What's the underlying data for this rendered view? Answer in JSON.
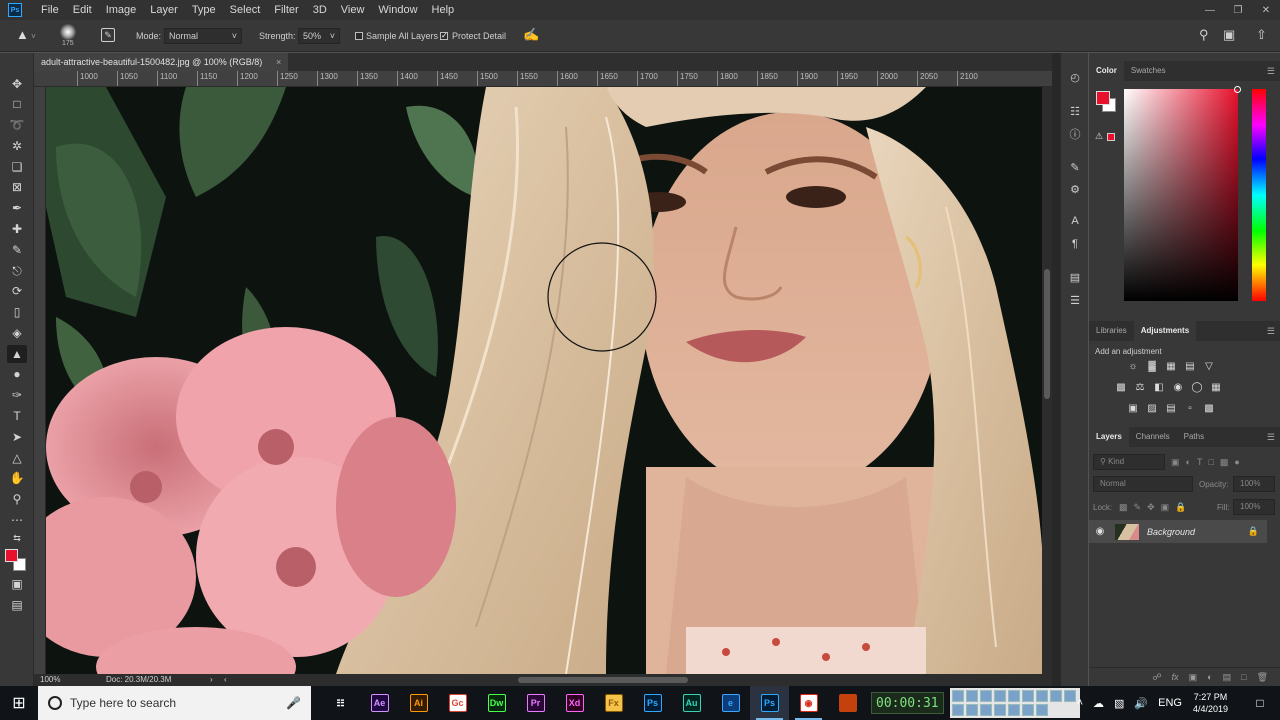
{
  "menu": {
    "app_icon": "Ps",
    "items": [
      "File",
      "Edit",
      "Image",
      "Layer",
      "Type",
      "Select",
      "Filter",
      "3D",
      "View",
      "Window",
      "Help"
    ]
  },
  "options_bar": {
    "brush_size": "175",
    "mode_label": "Mode:",
    "mode_value": "Normal",
    "strength_label": "Strength:",
    "strength_value": "50%",
    "sample_all_layers": "Sample All Layers",
    "sample_all_layers_checked": false,
    "protect_detail": "Protect Detail",
    "protect_detail_checked": true
  },
  "document": {
    "tab_title": "adult-attractive-beautiful-1500482.jpg @ 100% (RGB/8)",
    "close_glyph": "×",
    "ruler_ticks": [
      "1000",
      "1050",
      "1100",
      "1150",
      "1200",
      "1250",
      "1300",
      "1350",
      "1400",
      "1450",
      "1500",
      "1550",
      "1600",
      "1650",
      "1700",
      "1750",
      "1800",
      "1850",
      "1900",
      "1950",
      "2000",
      "2050",
      "2100"
    ],
    "zoom": "100%",
    "doc_size": "Doc: 20.3M/20.3M"
  },
  "colors": {
    "foreground": "#e8112d",
    "background": "#ffffff",
    "ps_blue": "#31a8ff"
  },
  "panels": {
    "color_tabs": [
      "Color",
      "Swatches"
    ],
    "adjust_tabs": [
      "Libraries",
      "Adjustments"
    ],
    "adjust_label": "Add an adjustment",
    "layers_tabs": [
      "Layers",
      "Channels",
      "Paths"
    ],
    "kind_placeholder": "Kind",
    "blend_mode": "Normal",
    "opacity_label": "Opacity:",
    "opacity_value": "100%",
    "lock_label": "Lock:",
    "fill_label": "Fill:",
    "fill_value": "100%",
    "layer_name": "Background"
  },
  "taskbar": {
    "search_placeholder": "Type here to search",
    "apps": [
      {
        "name": "Ae",
        "bg": "#1f0740",
        "fg": "#d291ff"
      },
      {
        "name": "Ai",
        "bg": "#331c00",
        "fg": "#ff9a00"
      },
      {
        "name": "Gc",
        "bg": "#ffffff",
        "fg": "#db4437"
      },
      {
        "name": "Dw",
        "bg": "#06280c",
        "fg": "#4cff4c"
      },
      {
        "name": "Pr",
        "bg": "#2a0636",
        "fg": "#e77cff"
      },
      {
        "name": "Xd",
        "bg": "#2e001f",
        "fg": "#ff61f6"
      },
      {
        "name": "Fx",
        "bg": "#f5c24a",
        "fg": "#8a5b00"
      },
      {
        "name": "Ps",
        "bg": "#001d36",
        "fg": "#31a8ff"
      },
      {
        "name": "Au",
        "bg": "#00271f",
        "fg": "#3ad1b6"
      },
      {
        "name": "e",
        "bg": "#0a3d7a",
        "fg": "#3aa6ff"
      },
      {
        "name": "Ps",
        "bg": "#001d36",
        "fg": "#31a8ff"
      },
      {
        "name": "◉",
        "bg": "#ffffff",
        "fg": "#d82a1a"
      },
      {
        "name": "■",
        "bg": "#c2410c",
        "fg": "#c2410c"
      }
    ],
    "timer": "00:00:31",
    "language": "ENG",
    "time": "7:27 PM",
    "date": "4/4/2019"
  }
}
